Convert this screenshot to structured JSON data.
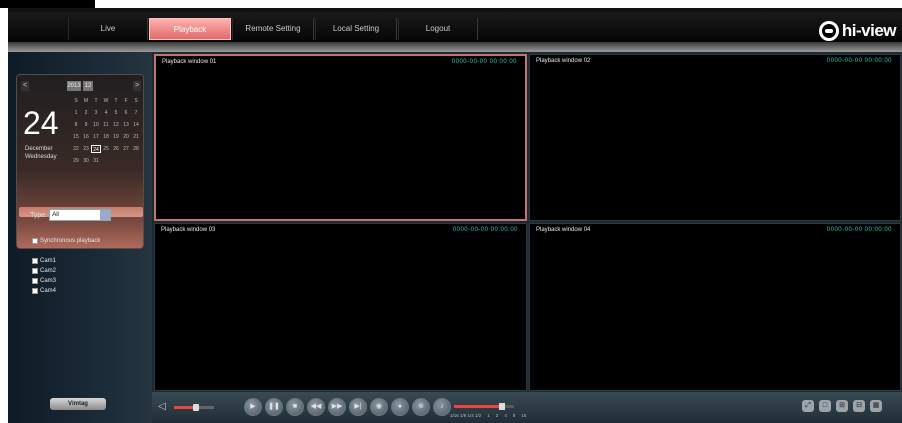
{
  "nav": {
    "tabs": [
      {
        "label": "Live"
      },
      {
        "label": "Playback"
      },
      {
        "label": "Remote Setting"
      },
      {
        "label": "Local Setting"
      },
      {
        "label": "Logout"
      }
    ],
    "active_tab": "Playback",
    "logo_text": "hi-view"
  },
  "calendar": {
    "prev_label": "<",
    "next_label": ">",
    "month_buttons": [
      "2013",
      "12"
    ],
    "day": "24",
    "month_text": "December",
    "year_text": "Wednesday",
    "weekdays": [
      "S",
      "M",
      "T",
      "W",
      "T",
      "F",
      "S"
    ],
    "dates": [
      "1",
      "2",
      "3",
      "4",
      "5",
      "6",
      "7",
      "8",
      "9",
      "10",
      "11",
      "12",
      "13",
      "14",
      "15",
      "16",
      "17",
      "18",
      "19",
      "20",
      "21",
      "22",
      "23",
      "24",
      "25",
      "26",
      "27",
      "28",
      "29",
      "30",
      "31"
    ],
    "selected_date": "24"
  },
  "filters": {
    "type_label": "Type",
    "type_value": "All",
    "sync_label": "Synchronous playback",
    "channels": [
      "Cam1",
      "Cam2",
      "Cam3",
      "Cam4"
    ]
  },
  "panes": [
    {
      "title": "Playback window 01",
      "time": "0000-00-00 00:00:00"
    },
    {
      "title": "Playback window 02",
      "time": "0000-00-00 00:00:00"
    },
    {
      "title": "Playback window 03",
      "time": "0000-00-00 00:00:00"
    },
    {
      "title": "Playback window 04",
      "time": "0000-00-00 00:00:00"
    }
  ],
  "brand": {
    "label": "Vimtag"
  },
  "toolbar": {
    "speaker_icon": "speaker-icon",
    "volume_level": 0.55,
    "controls": [
      "play",
      "pause",
      "stop",
      "slow",
      "fast",
      "step",
      "capture",
      "record",
      "zoom",
      "sound"
    ],
    "progress_level": 0.8,
    "speed_labels": [
      "1/16 1/8 1/4 1/2",
      "1",
      "2",
      "4",
      "8",
      "16"
    ],
    "right_icons": [
      "fullscreen-icon",
      "split-1-icon",
      "split-4-icon",
      "split-9-icon",
      "split-16-icon"
    ]
  },
  "colors": {
    "active_tab": "#e06a6a",
    "timestamp": "#33c8b0",
    "active_pane_border": "#c87070"
  }
}
